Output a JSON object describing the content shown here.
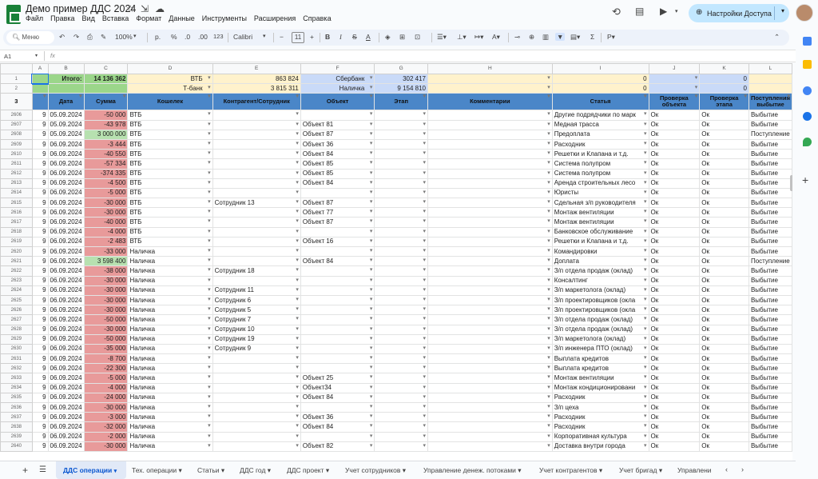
{
  "app": {
    "doc_title": "Демо пример ДДС 2024",
    "menu": [
      "Файл",
      "Правка",
      "Вид",
      "Вставка",
      "Формат",
      "Данные",
      "Инструменты",
      "Расширения",
      "Справка"
    ],
    "share_label": "Настройки Доступа"
  },
  "toolbar": {
    "search_placeholder": "Меню",
    "zoom": "100%",
    "currency": "р.",
    "percent": "%",
    "dec_less": ".0",
    "dec_more": ".00",
    "format_123": "123",
    "font": "Calibri",
    "font_size": "11"
  },
  "formula_bar": {
    "cell_ref": "A1",
    "fx": "fx"
  },
  "columns": [
    "A",
    "B",
    "C",
    "D",
    "E",
    "F",
    "G",
    "H",
    "I",
    "J",
    "K",
    "L"
  ],
  "summary": {
    "row1": {
      "label": "Итого:",
      "total": "14 136 362",
      "wallet1": "ВТБ",
      "wallet1_value": "863 824",
      "wallet2": "Сбербанк",
      "wallet2_value": "302 417",
      "i_value": "0",
      "k_value": "0"
    },
    "row2": {
      "wallet1": "Т-банк",
      "wallet1_value": "3 815 311",
      "wallet2": "Наличка",
      "wallet2_value": "9 154 810",
      "i_value": "0",
      "k_value": "0"
    }
  },
  "headers": [
    "Дата",
    "Сумма",
    "Кошелек",
    "Контрагент/Сотрудник",
    "Объект",
    "Этап",
    "Комментарии",
    "Статья",
    "Проверка объекта",
    "Проверка этапа",
    "Поступления выбытие"
  ],
  "rows": [
    {
      "n": "2606",
      "a": "9",
      "date": "05.09.2024",
      "sum": "-50 000",
      "wallet": "ВТБ",
      "cp": "",
      "obj": "",
      "art": "Другие подрядчики по марк",
      "j": "Ок",
      "k": "Ок",
      "l": "Выбытие"
    },
    {
      "n": "2607",
      "a": "9",
      "date": "05.09.2024",
      "sum": "-43 978",
      "wallet": "ВТБ",
      "cp": "",
      "obj": "Объект 81",
      "art": "Медная трасса",
      "j": "Ок",
      "k": "Ок",
      "l": "Выбытие"
    },
    {
      "n": "2608",
      "a": "9",
      "date": "05.09.2024",
      "sum": "3 000 000",
      "wallet": "ВТБ",
      "cp": "",
      "obj": "Объект 87",
      "art": "Предоплата",
      "j": "Ок",
      "k": "Ок",
      "l": "Поступление"
    },
    {
      "n": "2609",
      "a": "9",
      "date": "06.09.2024",
      "sum": "-3 444",
      "wallet": "ВТБ",
      "cp": "",
      "obj": "Объект 36",
      "art": "Расходник",
      "j": "Ок",
      "k": "Ок",
      "l": "Выбытие"
    },
    {
      "n": "2610",
      "a": "9",
      "date": "06.09.2024",
      "sum": "-40 550",
      "wallet": "ВТБ",
      "cp": "",
      "obj": "Объект 84",
      "art": "Решетки и Клапана и т.д.",
      "j": "Ок",
      "k": "Ок",
      "l": "Выбытие"
    },
    {
      "n": "2611",
      "a": "9",
      "date": "06.09.2024",
      "sum": "-57 334",
      "wallet": "ВТБ",
      "cp": "",
      "obj": "Объект 85",
      "art": "Система полупром",
      "j": "Ок",
      "k": "Ок",
      "l": "Выбытие"
    },
    {
      "n": "2612",
      "a": "9",
      "date": "06.09.2024",
      "sum": "-374 335",
      "wallet": "ВТБ",
      "cp": "",
      "obj": "Объект 85",
      "art": "Система полупром",
      "j": "Ок",
      "k": "Ок",
      "l": "Выбытие"
    },
    {
      "n": "2613",
      "a": "9",
      "date": "06.09.2024",
      "sum": "-4 500",
      "wallet": "ВТБ",
      "cp": "",
      "obj": "Объект 84",
      "art": "Аренда строительных лесо",
      "j": "Ок",
      "k": "Ок",
      "l": "Выбытие"
    },
    {
      "n": "2614",
      "a": "9",
      "date": "06.09.2024",
      "sum": "-5 000",
      "wallet": "ВТБ",
      "cp": "",
      "obj": "",
      "art": "Юристы",
      "j": "Ок",
      "k": "Ок",
      "l": "Выбытие"
    },
    {
      "n": "2615",
      "a": "9",
      "date": "06.09.2024",
      "sum": "-30 000",
      "wallet": "ВТБ",
      "cp": "Сотрудник 13",
      "obj": "Объект 87",
      "art": "Сдельная з/п руководителя",
      "j": "Ок",
      "k": "Ок",
      "l": "Выбытие"
    },
    {
      "n": "2616",
      "a": "9",
      "date": "06.09.2024",
      "sum": "-30 000",
      "wallet": "ВТБ",
      "cp": "",
      "obj": "Объект 77",
      "art": "Монтаж вентиляции",
      "j": "Ок",
      "k": "Ок",
      "l": "Выбытие"
    },
    {
      "n": "2617",
      "a": "9",
      "date": "06.09.2024",
      "sum": "-40 000",
      "wallet": "ВТБ",
      "cp": "",
      "obj": "Объект 87",
      "art": "Монтаж вентиляции",
      "j": "Ок",
      "k": "Ок",
      "l": "Выбытие"
    },
    {
      "n": "2618",
      "a": "9",
      "date": "06.09.2024",
      "sum": "-4 000",
      "wallet": "ВТБ",
      "cp": "",
      "obj": "",
      "art": "Банковское обслуживание",
      "j": "Ок",
      "k": "Ок",
      "l": "Выбытие"
    },
    {
      "n": "2619",
      "a": "9",
      "date": "06.09.2024",
      "sum": "-2 483",
      "wallet": "ВТБ",
      "cp": "",
      "obj": "Объект 16",
      "art": "Решетки и Клапана и т.д.",
      "j": "Ок",
      "k": "Ок",
      "l": "Выбытие"
    },
    {
      "n": "2620",
      "a": "9",
      "date": "06.09.2024",
      "sum": "-33 000",
      "wallet": "Наличка",
      "cp": "",
      "obj": "",
      "art": "Командировки",
      "j": "Ок",
      "k": "Ок",
      "l": "Выбытие"
    },
    {
      "n": "2621",
      "a": "9",
      "date": "06.09.2024",
      "sum": "3 598 400",
      "wallet": "Наличка",
      "cp": "",
      "obj": "Объект 84",
      "art": "Доплата",
      "j": "Ок",
      "k": "Ок",
      "l": "Поступление"
    },
    {
      "n": "2622",
      "a": "9",
      "date": "06.09.2024",
      "sum": "-38 000",
      "wallet": "Наличка",
      "cp": "Сотрудник 18",
      "obj": "",
      "art": "З/п отдела продаж (оклад)",
      "j": "Ок",
      "k": "Ок",
      "l": "Выбытие"
    },
    {
      "n": "2623",
      "a": "9",
      "date": "06.09.2024",
      "sum": "-30 000",
      "wallet": "Наличка",
      "cp": "",
      "obj": "",
      "art": "Консалтинг",
      "j": "Ок",
      "k": "Ок",
      "l": "Выбытие"
    },
    {
      "n": "2624",
      "a": "9",
      "date": "06.09.2024",
      "sum": "-30 000",
      "wallet": "Наличка",
      "cp": "Сотрудник 11",
      "obj": "",
      "art": "З/п маркетолога (оклад)",
      "j": "Ок",
      "k": "Ок",
      "l": "Выбытие"
    },
    {
      "n": "2625",
      "a": "9",
      "date": "06.09.2024",
      "sum": "-30 000",
      "wallet": "Наличка",
      "cp": "Сотрудник 6",
      "obj": "",
      "art": "З/п проектировщиков (окла",
      "j": "Ок",
      "k": "Ок",
      "l": "Выбытие"
    },
    {
      "n": "2626",
      "a": "9",
      "date": "06.09.2024",
      "sum": "-30 000",
      "wallet": "Наличка",
      "cp": "Сотрудник 5",
      "obj": "",
      "art": "З/п проектировщиков (окла",
      "j": "Ок",
      "k": "Ок",
      "l": "Выбытие"
    },
    {
      "n": "2627",
      "a": "9",
      "date": "06.09.2024",
      "sum": "-50 000",
      "wallet": "Наличка",
      "cp": "Сотрудник 7",
      "obj": "",
      "art": "З/п отдела продаж (оклад)",
      "j": "Ок",
      "k": "Ок",
      "l": "Выбытие"
    },
    {
      "n": "2628",
      "a": "9",
      "date": "06.09.2024",
      "sum": "-30 000",
      "wallet": "Наличка",
      "cp": "Сотрудник 10",
      "obj": "",
      "art": "З/п отдела продаж (оклад)",
      "j": "Ок",
      "k": "Ок",
      "l": "Выбытие"
    },
    {
      "n": "2629",
      "a": "9",
      "date": "06.09.2024",
      "sum": "-50 000",
      "wallet": "Наличка",
      "cp": "Сотрудник 19",
      "obj": "",
      "art": "З/п маркетолога (оклад)",
      "j": "Ок",
      "k": "Ок",
      "l": "Выбытие"
    },
    {
      "n": "2630",
      "a": "9",
      "date": "06.09.2024",
      "sum": "-35 000",
      "wallet": "Наличка",
      "cp": "Сотрудник 9",
      "obj": "",
      "art": "З/п инженера ПТО (оклад)",
      "j": "Ок",
      "k": "Ок",
      "l": "Выбытие"
    },
    {
      "n": "2631",
      "a": "9",
      "date": "06.09.2024",
      "sum": "-8 700",
      "wallet": "Наличка",
      "cp": "",
      "obj": "",
      "art": "Выплата кредитов",
      "j": "Ок",
      "k": "Ок",
      "l": "Выбытие"
    },
    {
      "n": "2632",
      "a": "9",
      "date": "06.09.2024",
      "sum": "-22 300",
      "wallet": "Наличка",
      "cp": "",
      "obj": "",
      "art": "Выплата кредитов",
      "j": "Ок",
      "k": "Ок",
      "l": "Выбытие"
    },
    {
      "n": "2633",
      "a": "9",
      "date": "06.09.2024",
      "sum": "-5 000",
      "wallet": "Наличка",
      "cp": "",
      "obj": "Объект 25",
      "art": "Монтаж вентиляции",
      "j": "Ок",
      "k": "Ок",
      "l": "Выбытие"
    },
    {
      "n": "2634",
      "a": "9",
      "date": "06.09.2024",
      "sum": "-4 000",
      "wallet": "Наличка",
      "cp": "",
      "obj": "Объект34",
      "art": "Монтаж кондиционировани",
      "j": "Ок",
      "k": "Ок",
      "l": "Выбытие"
    },
    {
      "n": "2635",
      "a": "9",
      "date": "06.09.2024",
      "sum": "-24 000",
      "wallet": "Наличка",
      "cp": "",
      "obj": "Объект 84",
      "art": "Расходник",
      "j": "Ок",
      "k": "Ок",
      "l": "Выбытие"
    },
    {
      "n": "2636",
      "a": "9",
      "date": "06.09.2024",
      "sum": "-30 000",
      "wallet": "Наличка",
      "cp": "",
      "obj": "",
      "art": "З/п цеха",
      "j": "Ок",
      "k": "Ок",
      "l": "Выбытие"
    },
    {
      "n": "2637",
      "a": "9",
      "date": "06.09.2024",
      "sum": "-3 000",
      "wallet": "Наличка",
      "cp": "",
      "obj": "Объект 36",
      "art": "Расходник",
      "j": "Ок",
      "k": "Ок",
      "l": "Выбытие"
    },
    {
      "n": "2638",
      "a": "9",
      "date": "06.09.2024",
      "sum": "-32 000",
      "wallet": "Наличка",
      "cp": "",
      "obj": "Объект 84",
      "art": "Расходник",
      "j": "Ок",
      "k": "Ок",
      "l": "Выбытие"
    },
    {
      "n": "2639",
      "a": "9",
      "date": "06.09.2024",
      "sum": "-2 000",
      "wallet": "Наличка",
      "cp": "",
      "obj": "",
      "art": "Корпоративная культура",
      "j": "Ок",
      "k": "Ок",
      "l": "Выбытие"
    },
    {
      "n": "2640",
      "a": "9",
      "date": "06.09.2024",
      "sum": "-30 000",
      "wallet": "Наличка",
      "cp": "",
      "obj": "Объект 82",
      "art": "Доставка внутри города",
      "j": "Ок",
      "k": "Ок",
      "l": "Выбытие"
    }
  ],
  "tabs": [
    "ДДС операции",
    "Тех. операции",
    "Статьи",
    "ДДС год",
    "ДДС проект",
    "Учет сотрудников",
    "Управление денеж. потоками",
    "Учет контрагентов",
    "Учет бригад",
    "Управлени"
  ]
}
